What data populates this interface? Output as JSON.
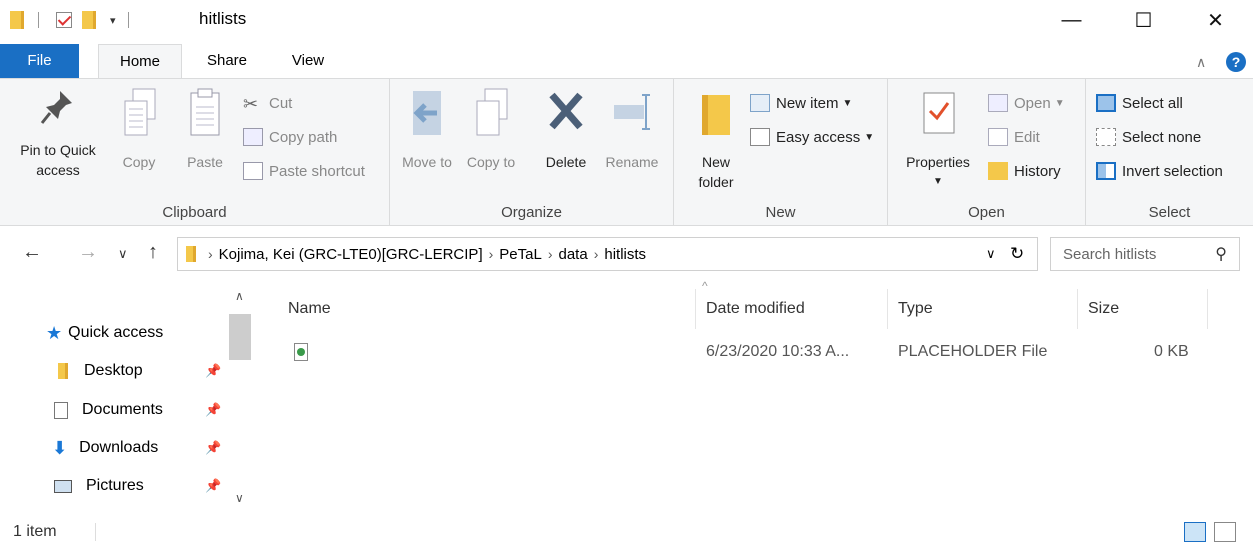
{
  "window": {
    "title": "hitlists",
    "minimize_glyph": "—",
    "maximize_glyph": "☐",
    "close_glyph": "✕"
  },
  "ribbon_tabs": {
    "file": "File",
    "home": "Home",
    "share": "Share",
    "view": "View"
  },
  "clipboard": {
    "pin": "Pin to Quick access",
    "copy": "Copy",
    "paste": "Paste",
    "cut": "Cut",
    "copy_path": "Copy path",
    "paste_shortcut": "Paste shortcut",
    "label": "Clipboard"
  },
  "organize": {
    "move_to": "Move to",
    "copy_to": "Copy to",
    "delete": "Delete",
    "rename": "Rename",
    "label": "Organize"
  },
  "new_group": {
    "new_folder": "New folder",
    "new_item": "New item",
    "easy_access": "Easy access",
    "label": "New"
  },
  "open_group": {
    "properties": "Properties",
    "open": "Open",
    "edit": "Edit",
    "history": "History",
    "label": "Open"
  },
  "select_group": {
    "select_all": "Select all",
    "select_none": "Select none",
    "invert": "Invert selection",
    "label": "Select"
  },
  "address": {
    "crumbs": [
      "Kojima, Kei (GRC-LTE0)[GRC-LERCIP]",
      "PeTaL",
      "data",
      "hitlists"
    ],
    "search_placeholder": "Search hitlists"
  },
  "nav_pane": {
    "quick_access": "Quick access",
    "items": [
      "Desktop",
      "Documents",
      "Downloads",
      "Pictures"
    ]
  },
  "columns": {
    "name": "Name",
    "date": "Date modified",
    "type": "Type",
    "size": "Size"
  },
  "files": [
    {
      "name": "",
      "date": "6/23/2020 10:33 A...",
      "type": "PLACEHOLDER File",
      "size": "0 KB"
    }
  ],
  "status": {
    "count": "1 item"
  },
  "colors": {
    "accent": "#1a6fc4",
    "folder": "#f4c84a",
    "ribbon_bg": "#f5f6f7"
  }
}
